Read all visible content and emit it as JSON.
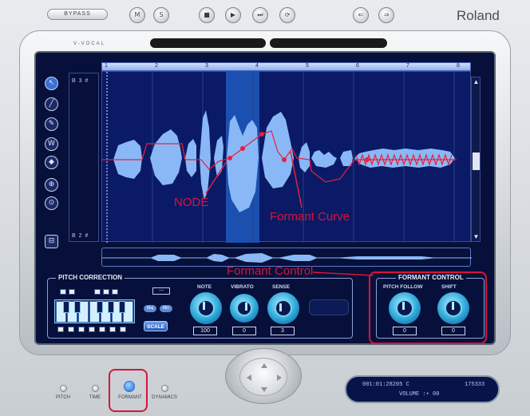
{
  "header": {
    "bypass_label": "BYPASS",
    "brand": "Roland",
    "transport_buttons": [
      {
        "glyph": "M",
        "icon": "m-icon"
      },
      {
        "glyph": "S",
        "icon": "s-icon"
      },
      {
        "glyph": "■",
        "icon": "stop-icon"
      },
      {
        "glyph": "▶",
        "icon": "play-icon"
      },
      {
        "glyph": "⏭",
        "icon": "forward-icon"
      },
      {
        "glyph": "⟳",
        "icon": "loop-icon"
      },
      {
        "glyph": "⇐",
        "icon": "undo-icon"
      },
      {
        "glyph": "⇒",
        "icon": "redo-icon"
      }
    ]
  },
  "window": {
    "title": "V-VOCAL"
  },
  "editor": {
    "ruler_marks": [
      "1",
      "2",
      "3",
      "4",
      "5",
      "6",
      "7",
      "8"
    ],
    "note_top": "B 3 #",
    "note_bottom": "B 2 #",
    "tools": [
      {
        "glyph": "↖",
        "icon": "pointer-tool-icon"
      },
      {
        "glyph": "╱",
        "icon": "line-tool-icon"
      },
      {
        "glyph": "✎",
        "icon": "pencil-tool-icon"
      },
      {
        "glyph": "W",
        "icon": "wave-tool-icon"
      },
      {
        "glyph": "◆",
        "icon": "eraser-tool-icon"
      },
      {
        "glyph": "⊕",
        "icon": "scrub-tool-icon"
      },
      {
        "glyph": "⊙",
        "icon": "zoom-tool-icon"
      },
      {
        "glyph": "⊟",
        "icon": "grid-tool-icon"
      }
    ],
    "annotations": {
      "node": "NODE",
      "formant_curve": "Formant Curve",
      "formant_control": "Formant Control"
    }
  },
  "pitch_correction": {
    "title": "PITCH CORRECTION",
    "maj_label": "Maj",
    "min_label": "Min",
    "scale_label": "SCALE",
    "key_box": "—",
    "knobs": [
      {
        "label": "NOTE",
        "value": "100"
      },
      {
        "label": "VIBRATO",
        "value": "0"
      },
      {
        "label": "SENSE",
        "value": "3"
      }
    ]
  },
  "formant_control": {
    "title": "FORMANT CONTROL",
    "knobs": [
      {
        "label": "PITCH FOLLOW",
        "value": "0"
      },
      {
        "label": "SHIFT",
        "value": "0"
      }
    ]
  },
  "modes": [
    {
      "label": "PITCH",
      "selected": false
    },
    {
      "label": "TIME",
      "selected": false
    },
    {
      "label": "FORMANT",
      "selected": true
    },
    {
      "label": "DYNAMICS",
      "selected": false
    }
  ],
  "display": {
    "line1_left": "001:01:28205 C",
    "line1_right": "175333",
    "line2": "VOLUME    :+    00"
  },
  "colors": {
    "screen": "#06103a",
    "waveform": "#8ab8f6",
    "annotation": "#d8143a",
    "curve": "#e8203c"
  }
}
